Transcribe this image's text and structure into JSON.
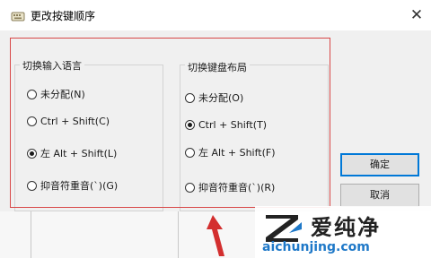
{
  "window": {
    "title": "更改按键顺序",
    "close_label": "✕",
    "icon": "keyboard-icon"
  },
  "input_language_group": {
    "legend": "切换输入语言",
    "options": [
      {
        "label": "未分配(N)",
        "selected": false
      },
      {
        "label": "Ctrl + Shift(C)",
        "selected": false
      },
      {
        "label": "左 Alt + Shift(L)",
        "selected": true
      },
      {
        "label": "抑音符重音(`)(G)",
        "selected": false
      }
    ]
  },
  "keyboard_layout_group": {
    "legend": "切换键盘布局",
    "options": [
      {
        "label": "未分配(O)",
        "selected": false
      },
      {
        "label": "Ctrl + Shift(T)",
        "selected": true
      },
      {
        "label": "左 Alt + Shift(F)",
        "selected": false
      },
      {
        "label": "抑音符重音(`)(R)",
        "selected": false
      }
    ]
  },
  "buttons": {
    "ok": "确定",
    "cancel": "取消"
  },
  "watermark": {
    "brand_cn": "爱纯净",
    "url": "aichunjing.com"
  },
  "colors": {
    "annotation": "#d84848",
    "arrow": "#d32f2f",
    "default_button_border": "#0078d7",
    "watermark_url": "#1e78c8"
  }
}
